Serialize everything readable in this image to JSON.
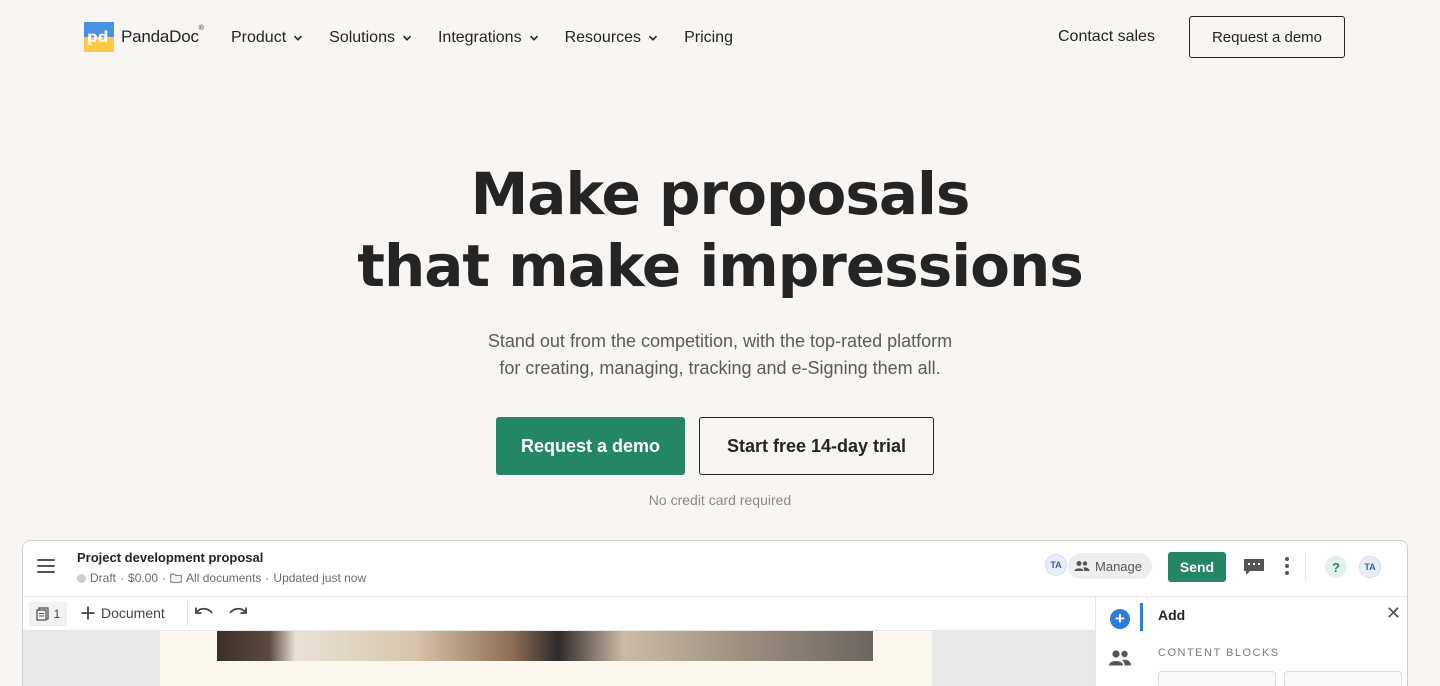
{
  "nav": {
    "logo_text": "PandaDoc",
    "logo_reg": "®",
    "menu": [
      {
        "label": "Product",
        "has_dropdown": true
      },
      {
        "label": "Solutions",
        "has_dropdown": true
      },
      {
        "label": "Integrations",
        "has_dropdown": true
      },
      {
        "label": "Resources",
        "has_dropdown": true
      },
      {
        "label": "Pricing",
        "has_dropdown": false
      }
    ],
    "contact_label": "Contact sales",
    "demo_label": "Request a demo"
  },
  "hero": {
    "title_line1": "Make proposals",
    "title_line2": "that make impressions",
    "subtitle_line1": "Stand out from the competition, with the top-rated platform",
    "subtitle_line2": "for creating, managing, tracking and e-Signing them all.",
    "cta_primary": "Request a demo",
    "cta_secondary": "Start free 14-day trial",
    "note": "No credit card required"
  },
  "preview": {
    "doc_title": "Project development proposal",
    "status": "Draft",
    "amount": "$0.00",
    "folder": "All documents",
    "updated": "Updated just now",
    "avatar_initials": "TA",
    "manage_label": "Manage",
    "send_label": "Send",
    "help_label": "?",
    "pages_count": "1",
    "add_document_label": "Document",
    "panel_title": "Add",
    "panel_section": "CONTENT BLOCKS"
  },
  "colors": {
    "background": "#f8f5f3",
    "brand_green": "#248567",
    "text": "#242424",
    "accent_blue": "#2f7bd8"
  },
  "icons": [
    "chevron-down-icon",
    "hamburger-icon",
    "folder-icon",
    "people-icon",
    "comment-icon",
    "more-vertical-icon",
    "help-icon",
    "pages-icon",
    "plus-icon",
    "undo-icon",
    "redo-icon",
    "close-icon"
  ]
}
